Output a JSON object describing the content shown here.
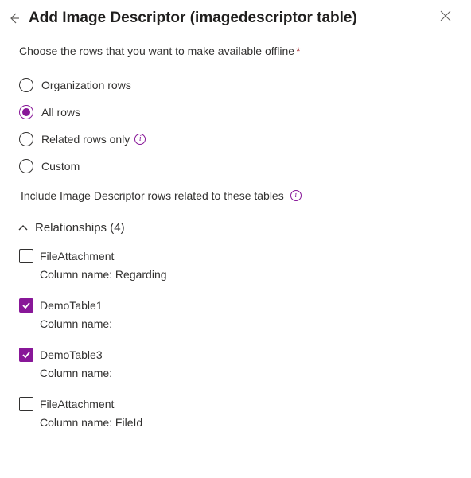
{
  "header": {
    "title": "Add Image Descriptor (imagedescriptor table)"
  },
  "prompt": "Choose the rows that you want to make available offline",
  "radios": [
    {
      "label": "Organization rows",
      "selected": false,
      "info": false
    },
    {
      "label": "All rows",
      "selected": true,
      "info": false
    },
    {
      "label": "Related rows only",
      "selected": false,
      "info": true
    },
    {
      "label": "Custom",
      "selected": false,
      "info": false
    }
  ],
  "subhead": "Include Image Descriptor rows related to these tables",
  "section": {
    "label": "Relationships",
    "count": 4
  },
  "column_prefix": "Column name:",
  "relationships": [
    {
      "name": "FileAttachment",
      "column": "Regarding",
      "checked": false
    },
    {
      "name": "DemoTable1",
      "column": "",
      "checked": true
    },
    {
      "name": "DemoTable3",
      "column": "",
      "checked": true
    },
    {
      "name": "FileAttachment",
      "column": "FileId",
      "checked": false
    }
  ]
}
